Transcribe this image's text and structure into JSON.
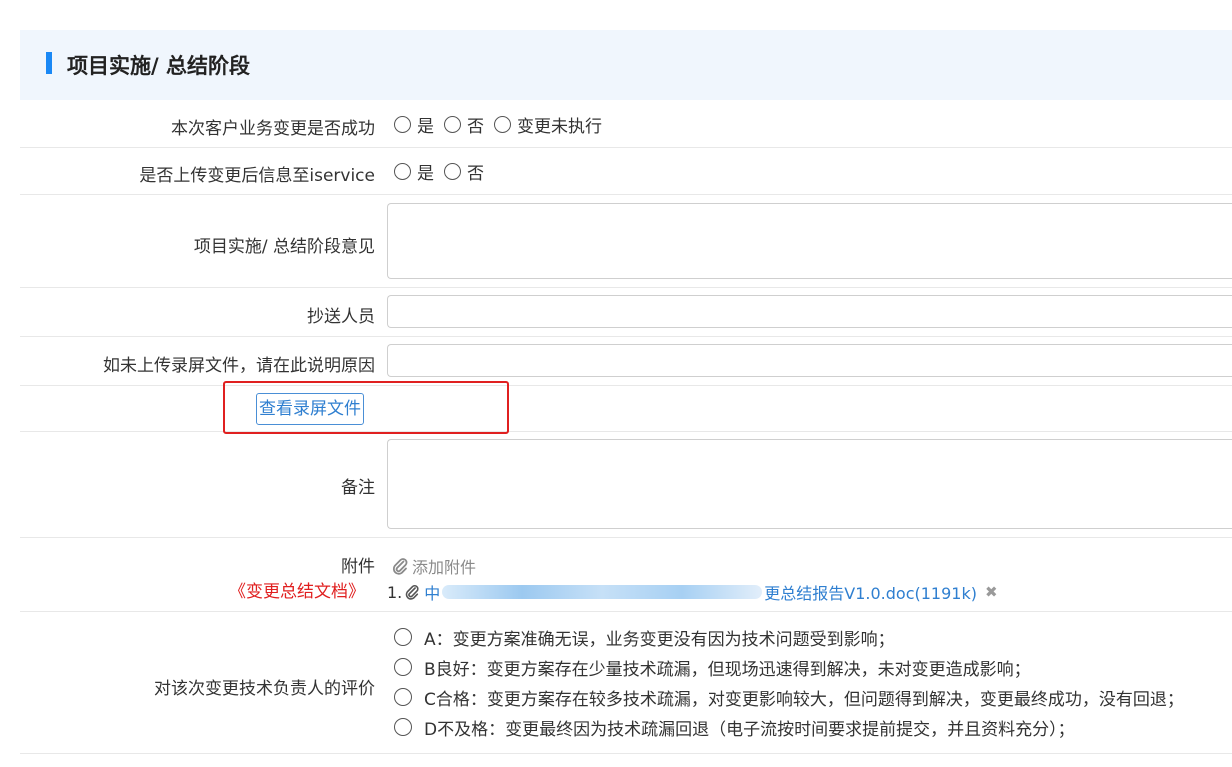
{
  "section": {
    "title": "项目实施/ 总结阶段"
  },
  "rows": {
    "success": {
      "label": "本次客户业务变更是否成功",
      "options": [
        "是",
        "否",
        "变更未执行"
      ]
    },
    "upload_iservice": {
      "label": "是否上传变更后信息至iservice",
      "options": [
        "是",
        "否"
      ]
    },
    "opinion": {
      "label": "项目实施/ 总结阶段意见",
      "value": ""
    },
    "cc": {
      "label": "抄送人员",
      "value": ""
    },
    "reason": {
      "label": "如未上传录屏文件，请在此说明原因",
      "value": ""
    },
    "view_recording": {
      "button_label": "查看录屏文件"
    },
    "remark": {
      "label": "备注",
      "value": ""
    },
    "attachment": {
      "label": "附件",
      "note": "《变更总结文档》",
      "add_label": "添加附件",
      "file_index": "1.",
      "file_prefix": "中",
      "file_suffix": "更总结报告V1.0.doc(1191k)"
    },
    "evaluation": {
      "label": "对该次变更技术负责人的评价",
      "options": [
        "A：变更方案准确无误，业务变更没有因为技术问题受到影响；",
        "B良好：变更方案存在少量技术疏漏，但现场迅速得到解决，未对变更造成影响；",
        "C合格：变更方案存在较多技术疏漏，对变更影响较大，但问题得到解决，变更最终成功，没有回退；",
        "D不及格：变更最终因为技术疏漏回退（电子流按时间要求提前提交，并且资料充分）；"
      ]
    }
  },
  "colors": {
    "accent": "#1a88f5",
    "link": "#2f7fd0",
    "highlight": "#e02020",
    "header_bg": "#f0f6fd"
  }
}
